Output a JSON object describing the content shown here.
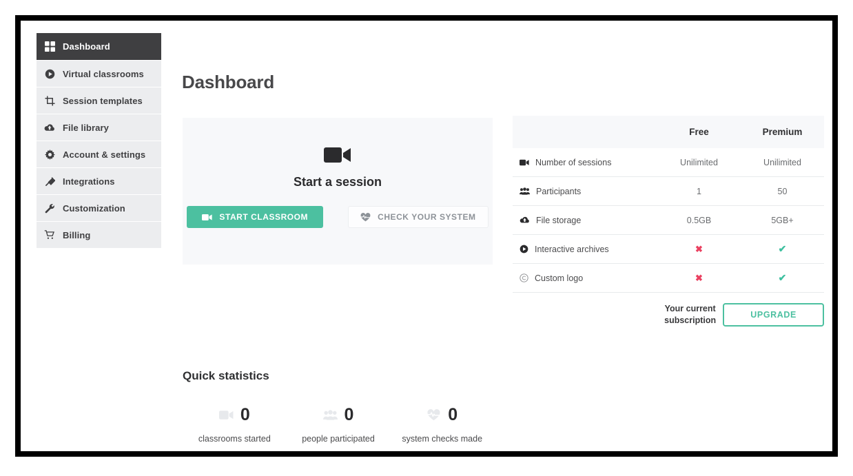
{
  "sidebar": {
    "items": [
      {
        "label": "Dashboard",
        "icon": "grid-icon",
        "active": true
      },
      {
        "label": "Virtual classrooms",
        "icon": "play-circle-icon",
        "active": false
      },
      {
        "label": "Session templates",
        "icon": "crop-icon",
        "active": false
      },
      {
        "label": "File library",
        "icon": "cloud-upload-icon",
        "active": false
      },
      {
        "label": "Account & settings",
        "icon": "gear-icon",
        "active": false
      },
      {
        "label": "Integrations",
        "icon": "plug-icon",
        "active": false
      },
      {
        "label": "Customization",
        "icon": "wrench-icon",
        "active": false
      },
      {
        "label": "Billing",
        "icon": "cart-icon",
        "active": false
      }
    ]
  },
  "main": {
    "page_title": "Dashboard"
  },
  "session_card": {
    "icon": "video-camera-icon",
    "heading": "Start a session",
    "start_button": {
      "label": "START CLASSROOM",
      "icon": "video-camera-icon"
    },
    "check_button": {
      "label": "CHECK YOUR SYSTEM",
      "icon": "heartbeat-icon"
    }
  },
  "plan_table": {
    "columns": [
      "",
      "Free",
      "Premium"
    ],
    "rows": [
      {
        "icon": "video-camera-icon",
        "feature": "Number of sessions",
        "free": "Unilimited",
        "premium": "Unilimited",
        "type": "text"
      },
      {
        "icon": "users-icon",
        "feature": "Participants",
        "free": "1",
        "premium": "50",
        "type": "text"
      },
      {
        "icon": "cloud-upload-icon",
        "feature": "File storage",
        "free": "0.5GB",
        "premium": "5GB+",
        "type": "text"
      },
      {
        "icon": "play-circle-icon",
        "feature": "Interactive archives",
        "free": "✖",
        "premium": "✔",
        "type": "mark"
      },
      {
        "icon": "copyright-icon",
        "feature": "Custom logo",
        "free": "✖",
        "premium": "✔",
        "type": "mark"
      }
    ],
    "subscription_note": "Your current\nsubscription",
    "upgrade_label": "UPGRADE"
  },
  "quick_statistics": {
    "title": "Quick statistics",
    "items": [
      {
        "icon": "video-camera-icon",
        "value": "0",
        "caption": "classrooms started"
      },
      {
        "icon": "users-icon",
        "value": "0",
        "caption": "people participated"
      },
      {
        "icon": "heartbeat-icon",
        "value": "0",
        "caption": "system checks made"
      }
    ]
  },
  "colors": {
    "accent": "#4cc0a0",
    "sidebar_active": "#3f3f41",
    "sidebar_item": "#ecedef",
    "card_bg": "#f7f8fa",
    "yes": "#3fc0a0",
    "no": "#ea4060"
  }
}
